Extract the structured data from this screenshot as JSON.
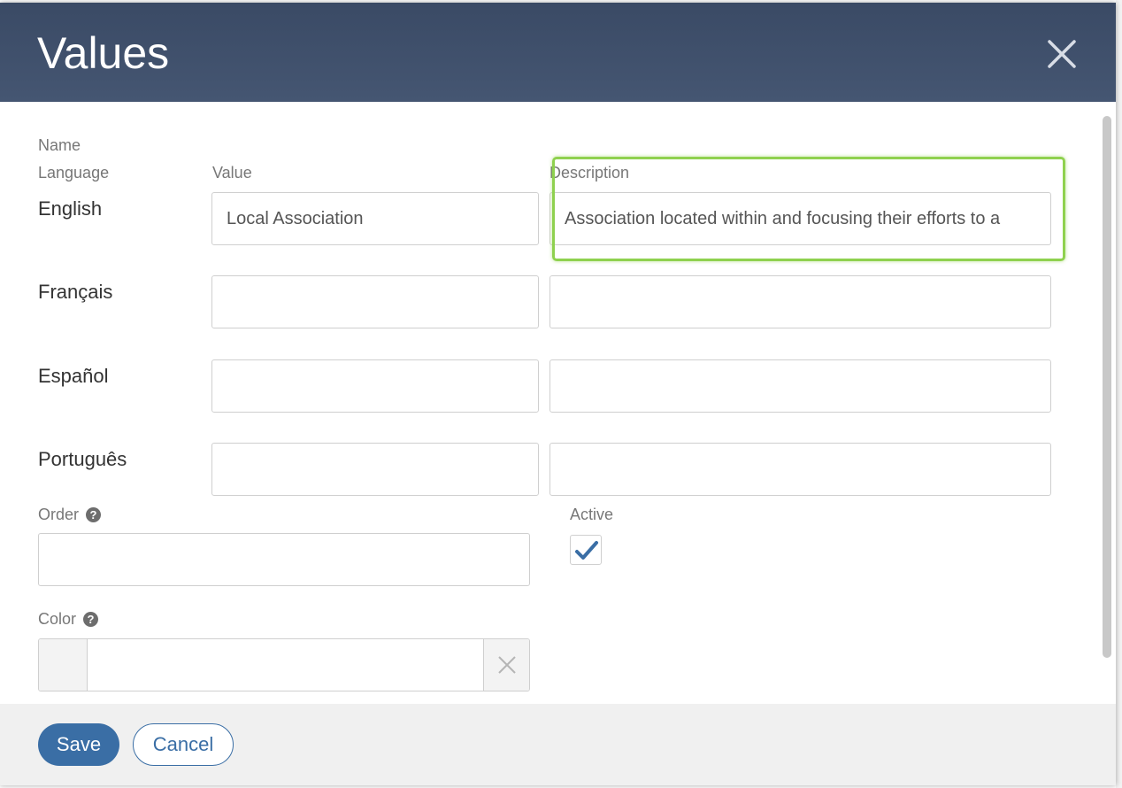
{
  "modal": {
    "title": "Values",
    "close_icon": "close-icon"
  },
  "form": {
    "name_label": "Name",
    "language_header": "Language",
    "value_header": "Value",
    "description_header": "Description",
    "languages": [
      {
        "name": "English",
        "value": "Local Association",
        "description": "Association located within and focusing their efforts to a"
      },
      {
        "name": "Français",
        "value": "",
        "description": ""
      },
      {
        "name": "Español",
        "value": "",
        "description": ""
      },
      {
        "name": "Português",
        "value": "",
        "description": ""
      }
    ],
    "order_label": "Order",
    "order_help_icon": "question-circle-icon",
    "order_value": "",
    "active_label": "Active",
    "active_checked": true,
    "color_label": "Color",
    "color_help_icon": "question-circle-icon",
    "color_value": ""
  },
  "footer": {
    "save_label": "Save",
    "cancel_label": "Cancel"
  },
  "colors": {
    "header_bg": "#3f4f6b",
    "primary": "#3a6ea5",
    "highlight": "#8fd14f"
  }
}
